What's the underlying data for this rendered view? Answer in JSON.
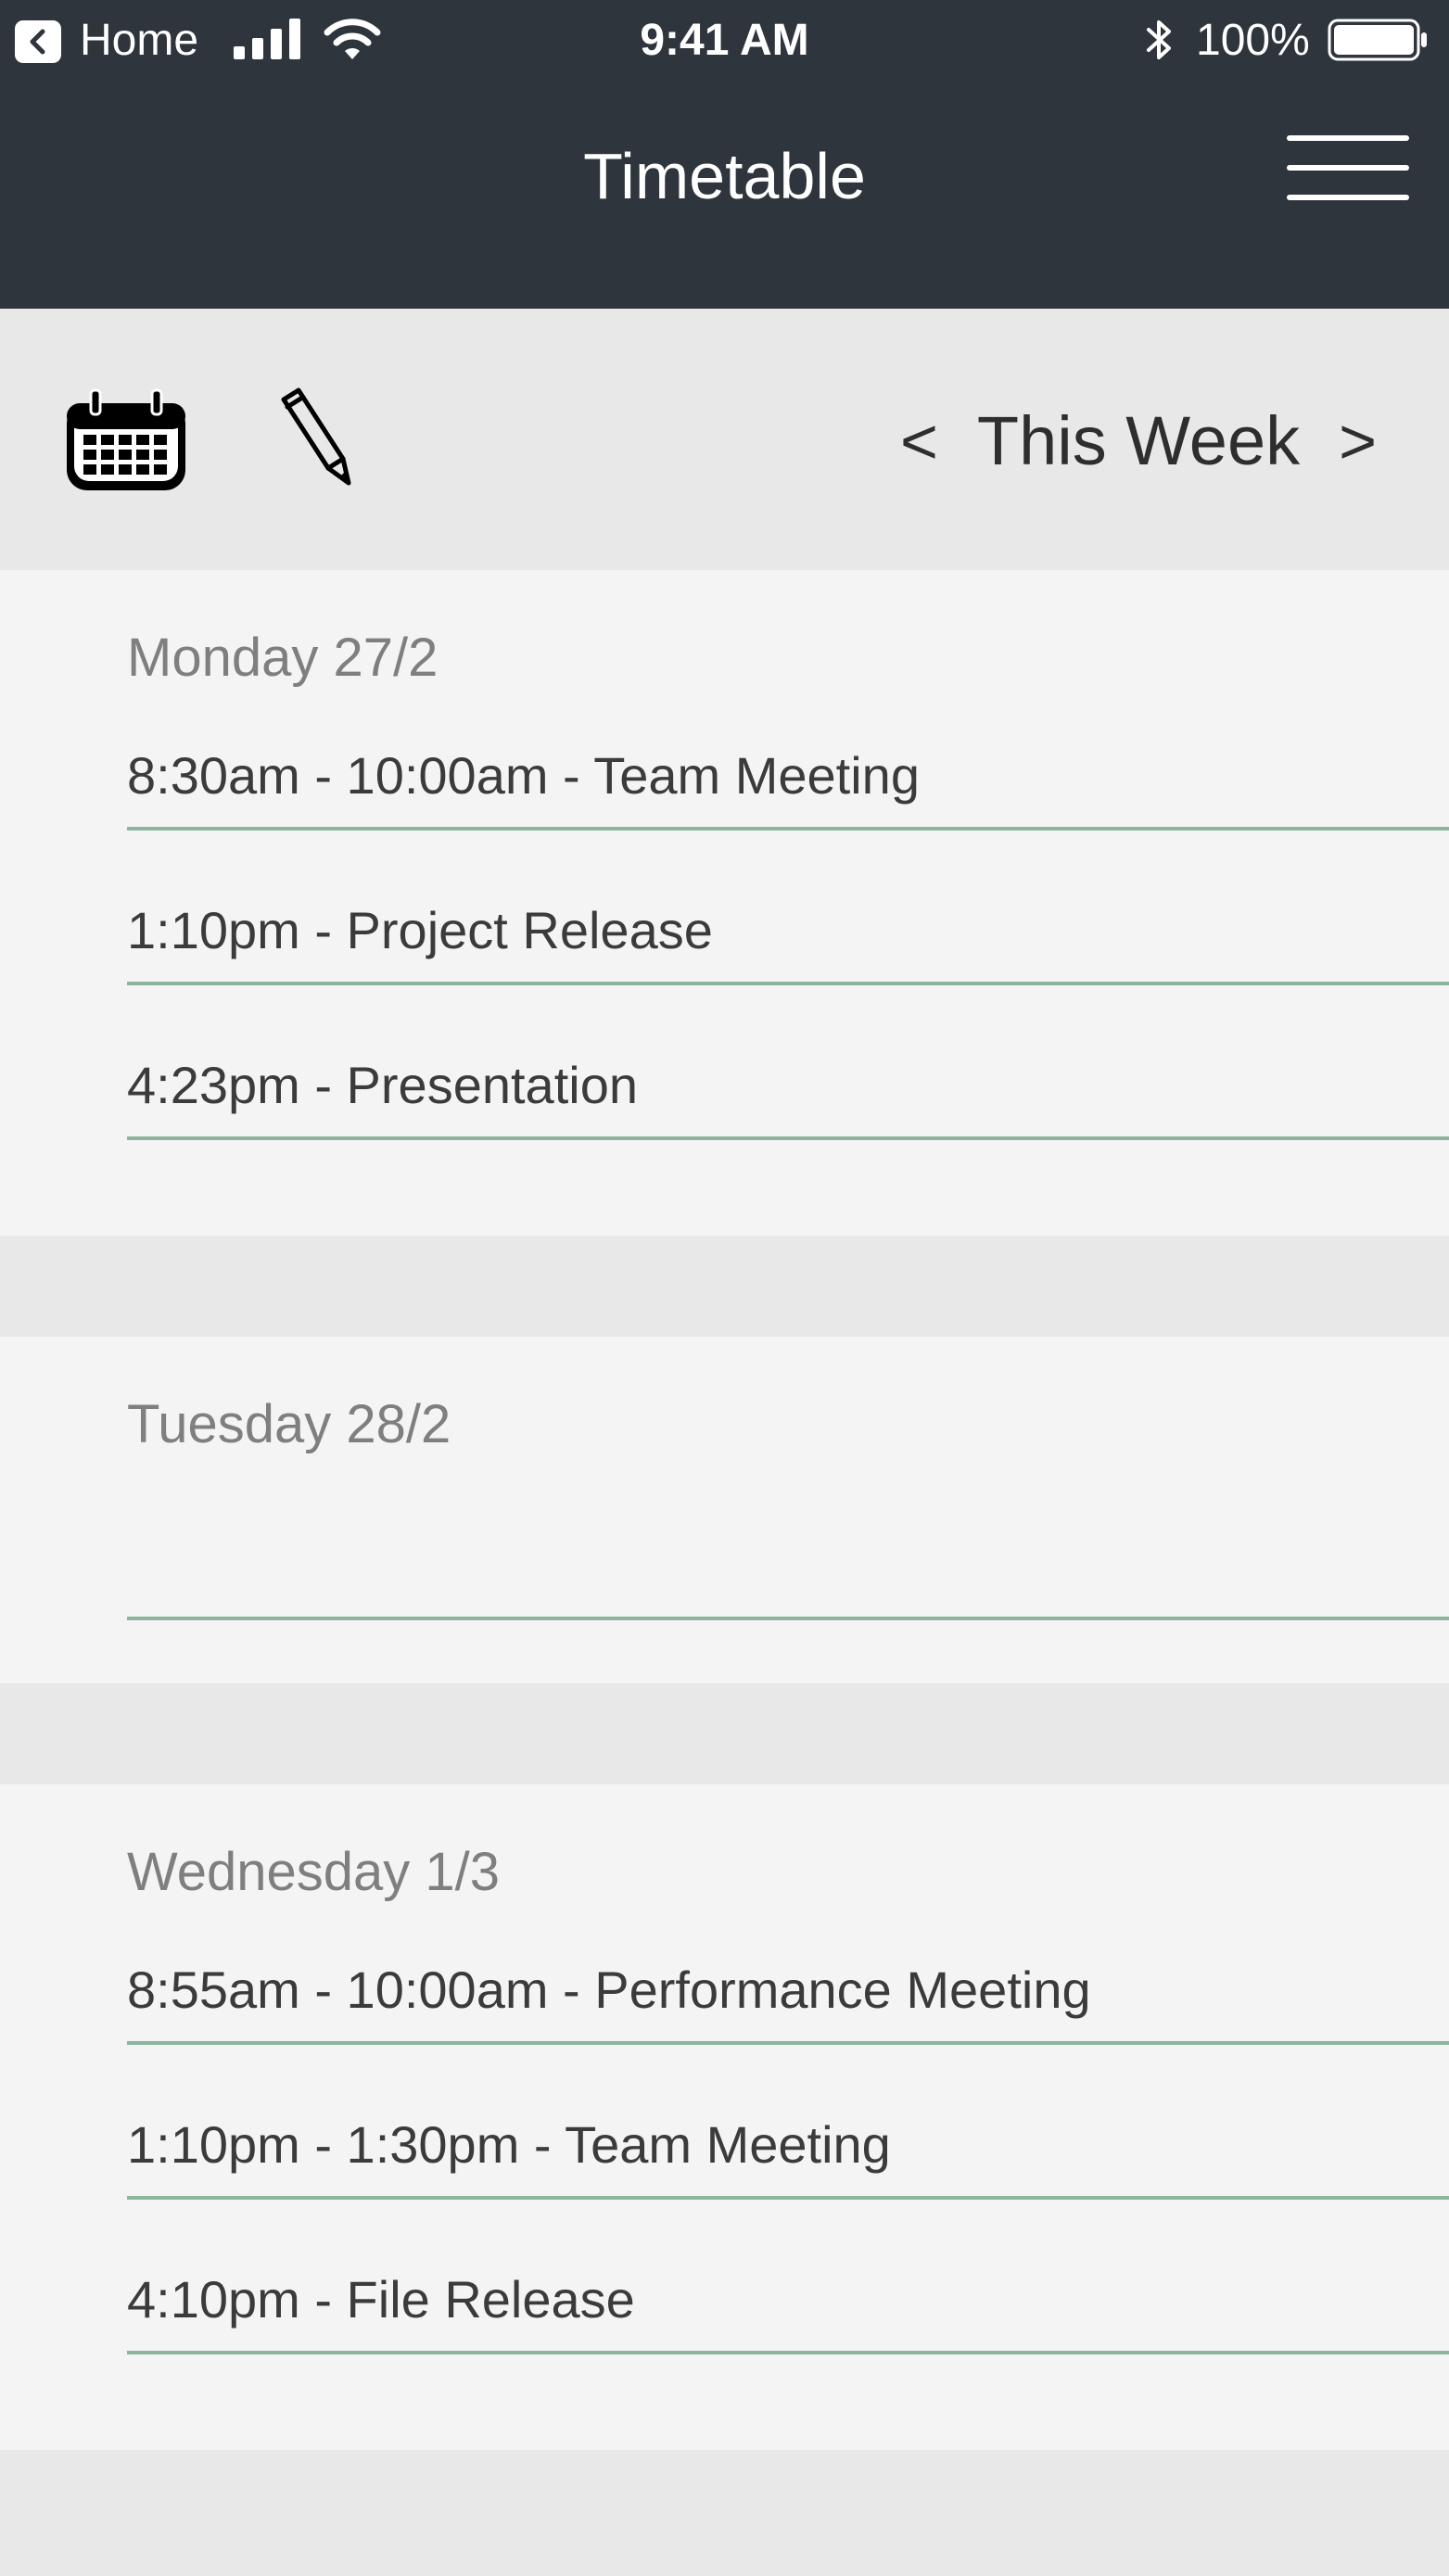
{
  "status_bar": {
    "back_label": "Home",
    "time": "9:41 AM",
    "battery": "100%"
  },
  "nav": {
    "title": "Timetable",
    "menu_icon": "hamburger-menu-icon"
  },
  "toolbar": {
    "calendar_icon": "calendar-icon",
    "edit_icon": "pencil-icon",
    "prev_arrow": "<",
    "week_label": "This Week",
    "next_arrow": ">"
  },
  "days": [
    {
      "title": "Monday 27/2",
      "events": [
        "8:30am - 10:00am - Team Meeting",
        "1:10pm - Project Release",
        "4:23pm - Presentation"
      ]
    },
    {
      "title": "Tuesday 28/2",
      "events": []
    },
    {
      "title": "Wednesday 1/3",
      "events": [
        "8:55am - 10:00am - Performance Meeting",
        "1:10pm - 1:30pm - Team Meeting",
        "4:10pm - File Release"
      ]
    }
  ],
  "colors": {
    "header": "#2f353d",
    "divider": "#8db59c",
    "section_bg": "#f5f4f5",
    "page_bg": "#e8e8e9"
  }
}
